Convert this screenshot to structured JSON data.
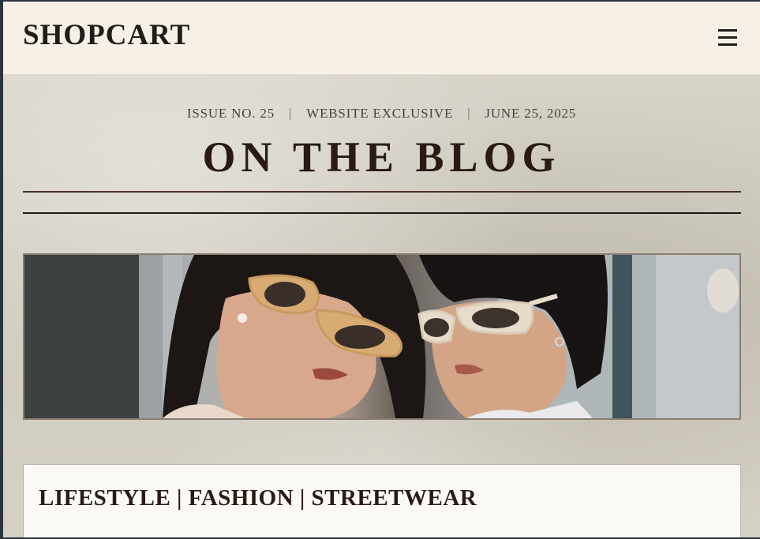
{
  "header": {
    "logo": "SHOPCART",
    "menu_icon": "hamburger-menu-icon"
  },
  "masthead": {
    "issue": "ISSUE NO. 25",
    "separator": "|",
    "edition": "WEBSITE EXCLUSIVE",
    "date": "JUNE 25, 2025",
    "title": "ON THE BLOG"
  },
  "hero": {
    "image": "two-people-wearing-cat-eye-sunglasses-photo"
  },
  "card": {
    "title": "LIFESTYLE | FASHION | STREETWEAR"
  },
  "colors": {
    "header_bg": "#f7f0e7",
    "title_text": "#2a1a14",
    "page_bg": "#d7d2c6",
    "card_bg": "#fbf9f6"
  }
}
